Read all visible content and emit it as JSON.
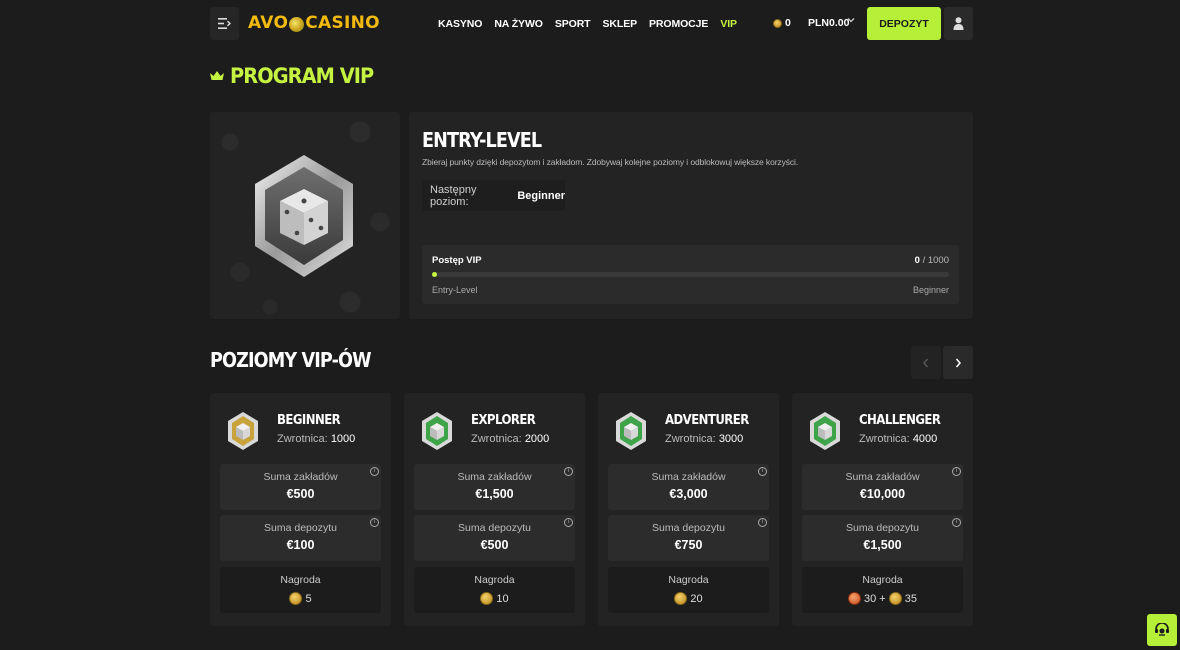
{
  "header": {
    "menu_icon": "menu-collapse-icon",
    "logo_prefix": "AVO",
    "logo_suffix": "CASINO",
    "nav": [
      {
        "label": "KASYNO"
      },
      {
        "label": "NA ŻYWO"
      },
      {
        "label": "SPORT"
      },
      {
        "label": "SKLEP"
      },
      {
        "label": "PROMOCJE"
      },
      {
        "label": "VIP",
        "active": true
      }
    ],
    "coins": "0",
    "balance": "PLN0.00",
    "deposit_label": "DEPOZYT",
    "user_icon": "user-icon",
    "accent_color": "#c6f341",
    "deposit_color": "#b6ef38"
  },
  "vip": {
    "title": "PROGRAM VIP",
    "current_level": "ENTRY-LEVEL",
    "description": "Zbieraj punkty dzięki depozytom i zakładom. Zdobywaj kolejne poziomy i odblokowuj większe korzyści.",
    "next_level_label": "Następny poziom:",
    "next_level_value": "Beginner",
    "progress": {
      "label": "Postęp VIP",
      "current": "0",
      "separator": "/",
      "total": "1000",
      "fraction": 0,
      "from": "Entry-Level",
      "to": "Beginner"
    }
  },
  "levels": {
    "title": "POZIOMY VIP-ÓW",
    "cards": [
      {
        "name": "BEGINNER",
        "rakeback_label": "Zwrotnica:",
        "rakeback_value": "1000",
        "bets_label": "Suma zakładów",
        "bets_value": "€500",
        "deposits_label": "Suma depozytu",
        "deposits_value": "€100",
        "reward_label": "Nagroda",
        "reward_parts": [
          "5"
        ],
        "icon_color": "#c8a23a"
      },
      {
        "name": "EXPLORER",
        "rakeback_label": "Zwrotnica:",
        "rakeback_value": "2000",
        "bets_label": "Suma zakładów",
        "bets_value": "€1,500",
        "deposits_label": "Suma depozytu",
        "deposits_value": "€500",
        "reward_label": "Nagroda",
        "reward_parts": [
          "10"
        ],
        "icon_color": "#3fa34a"
      },
      {
        "name": "ADVENTURER",
        "rakeback_label": "Zwrotnica:",
        "rakeback_value": "3000",
        "bets_label": "Suma zakładów",
        "bets_value": "€3,000",
        "deposits_label": "Suma depozytu",
        "deposits_value": "€750",
        "reward_label": "Nagroda",
        "reward_parts": [
          "20"
        ],
        "icon_color": "#3fa34a"
      },
      {
        "name": "CHALLENGER",
        "rakeback_label": "Zwrotnica:",
        "rakeback_value": "4000",
        "bets_label": "Suma zakładów",
        "bets_value": "€10,000",
        "deposits_label": "Suma depozytu",
        "deposits_value": "€1,500",
        "reward_label": "Nagroda",
        "reward_parts": [
          "30",
          "+",
          "35"
        ],
        "icon_color": "#3fa34a"
      }
    ]
  }
}
